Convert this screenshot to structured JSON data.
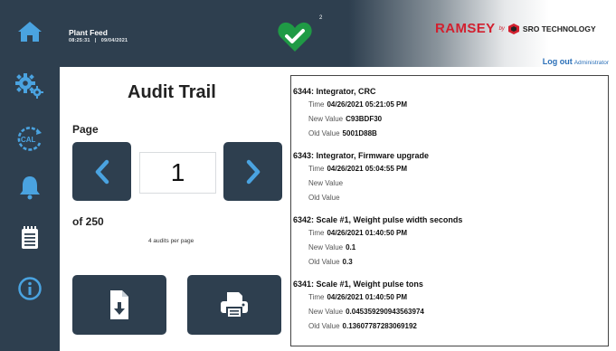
{
  "sidebar": {
    "items": [
      {
        "icon": "home-icon"
      },
      {
        "icon": "gears-icon"
      },
      {
        "icon": "calibration-icon",
        "label": "CAL"
      },
      {
        "icon": "bell-icon"
      },
      {
        "icon": "notepad-icon"
      },
      {
        "icon": "info-icon"
      }
    ]
  },
  "header": {
    "plant_name": "Plant Feed",
    "time": "08:25:31",
    "separator": "|",
    "date": "09/04/2021",
    "status_count": "2",
    "brand": {
      "name": "RAMSEY",
      "by": "by",
      "partner": "SRO TECHNOLOGY"
    },
    "logout": {
      "label": "Log out",
      "user": "Administrator"
    }
  },
  "audit": {
    "title": "Audit Trail",
    "page_label": "Page",
    "current_page": "1",
    "of_label": "of 250",
    "per_page": "4 audits per page"
  },
  "colors": {
    "sidebar": "#2e3f4f",
    "status_ok": "#1f9a45",
    "brand_red": "#d2202f",
    "link": "#2a6fb8"
  },
  "log": {
    "time_label": "Time",
    "new_label": "New Value",
    "old_label": "Old Value",
    "entries": [
      {
        "title": "6344: Integrator, CRC",
        "time": "04/26/2021 05:21:05 PM",
        "new_value": "C93BDF30",
        "old_value": "5001D88B"
      },
      {
        "title": "6343: Integrator, Firmware upgrade",
        "time": "04/26/2021 05:04:55 PM",
        "new_value": "",
        "old_value": ""
      },
      {
        "title": "6342: Scale #1, Weight pulse width seconds",
        "time": "04/26/2021 01:40:50 PM",
        "new_value": "0.1",
        "old_value": "0.3"
      },
      {
        "title": "6341: Scale #1, Weight pulse tons",
        "time": "04/26/2021 01:40:50 PM",
        "new_value": "0.045359290943563974",
        "old_value": "0.13607787283069192"
      }
    ]
  }
}
